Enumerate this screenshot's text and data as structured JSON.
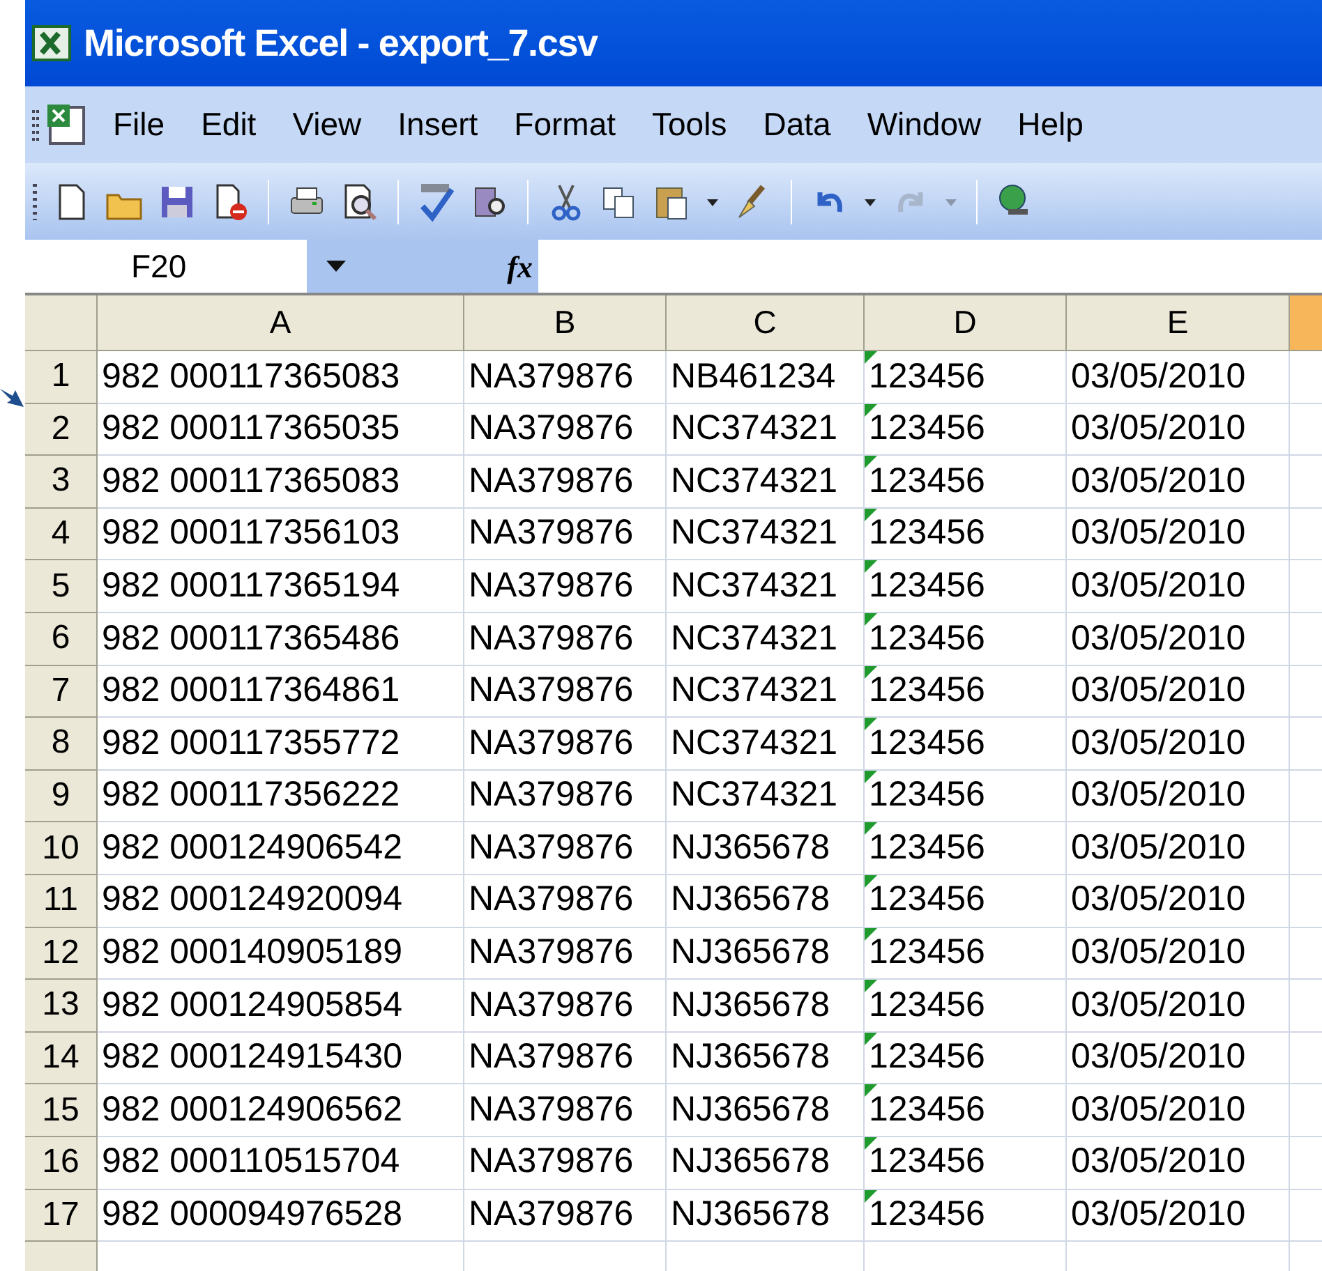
{
  "window": {
    "title": "Microsoft Excel - export_7.csv"
  },
  "menu": [
    "File",
    "Edit",
    "View",
    "Insert",
    "Format",
    "Tools",
    "Data",
    "Window",
    "Help"
  ],
  "name_box": "F20",
  "formula_bar": {
    "fx": "fx"
  },
  "columns": [
    {
      "label": "A",
      "selected": false
    },
    {
      "label": "B",
      "selected": false
    },
    {
      "label": "C",
      "selected": false
    },
    {
      "label": "D",
      "selected": false
    },
    {
      "label": "E",
      "selected": false
    },
    {
      "selected": true
    }
  ],
  "rows": [
    {
      "n": "1",
      "cells": [
        "982 000117365083",
        "NA379876",
        "NB461234",
        "123456",
        "03/05/2010"
      ],
      "d_text_warning": true
    },
    {
      "n": "2",
      "cells": [
        "982 000117365035",
        "NA379876",
        "NC374321",
        "123456",
        "03/05/2010"
      ],
      "d_text_warning": true
    },
    {
      "n": "3",
      "cells": [
        "982 000117365083",
        "NA379876",
        "NC374321",
        "123456",
        "03/05/2010"
      ],
      "d_text_warning": true
    },
    {
      "n": "4",
      "cells": [
        "982 000117356103",
        "NA379876",
        "NC374321",
        "123456",
        "03/05/2010"
      ],
      "d_text_warning": true
    },
    {
      "n": "5",
      "cells": [
        "982 000117365194",
        "NA379876",
        "NC374321",
        "123456",
        "03/05/2010"
      ],
      "d_text_warning": true
    },
    {
      "n": "6",
      "cells": [
        "982 000117365486",
        "NA379876",
        "NC374321",
        "123456",
        "03/05/2010"
      ],
      "d_text_warning": true
    },
    {
      "n": "7",
      "cells": [
        "982 000117364861",
        "NA379876",
        "NC374321",
        "123456",
        "03/05/2010"
      ],
      "d_text_warning": true
    },
    {
      "n": "8",
      "cells": [
        "982 000117355772",
        "NA379876",
        "NC374321",
        "123456",
        "03/05/2010"
      ],
      "d_text_warning": true
    },
    {
      "n": "9",
      "cells": [
        "982 000117356222",
        "NA379876",
        "NC374321",
        "123456",
        "03/05/2010"
      ],
      "d_text_warning": true
    },
    {
      "n": "10",
      "cells": [
        "982 000124906542",
        "NA379876",
        "NJ365678",
        "123456",
        "03/05/2010"
      ],
      "d_text_warning": true
    },
    {
      "n": "11",
      "cells": [
        "982 000124920094",
        "NA379876",
        "NJ365678",
        "123456",
        "03/05/2010"
      ],
      "d_text_warning": true
    },
    {
      "n": "12",
      "cells": [
        "982 000140905189",
        "NA379876",
        "NJ365678",
        "123456",
        "03/05/2010"
      ],
      "d_text_warning": true
    },
    {
      "n": "13",
      "cells": [
        "982 000124905854",
        "NA379876",
        "NJ365678",
        "123456",
        "03/05/2010"
      ],
      "d_text_warning": true
    },
    {
      "n": "14",
      "cells": [
        "982 000124915430",
        "NA379876",
        "NJ365678",
        "123456",
        "03/05/2010"
      ],
      "d_text_warning": true
    },
    {
      "n": "15",
      "cells": [
        "982 000124906562",
        "NA379876",
        "NJ365678",
        "123456",
        "03/05/2010"
      ],
      "d_text_warning": true
    },
    {
      "n": "16",
      "cells": [
        "982 000110515704",
        "NA379876",
        "NJ365678",
        "123456",
        "03/05/2010"
      ],
      "d_text_warning": true
    },
    {
      "n": "17",
      "cells": [
        "982 000094976528",
        "NA379876",
        "NJ365678",
        "123456",
        "03/05/2010"
      ],
      "d_text_warning": true
    }
  ]
}
